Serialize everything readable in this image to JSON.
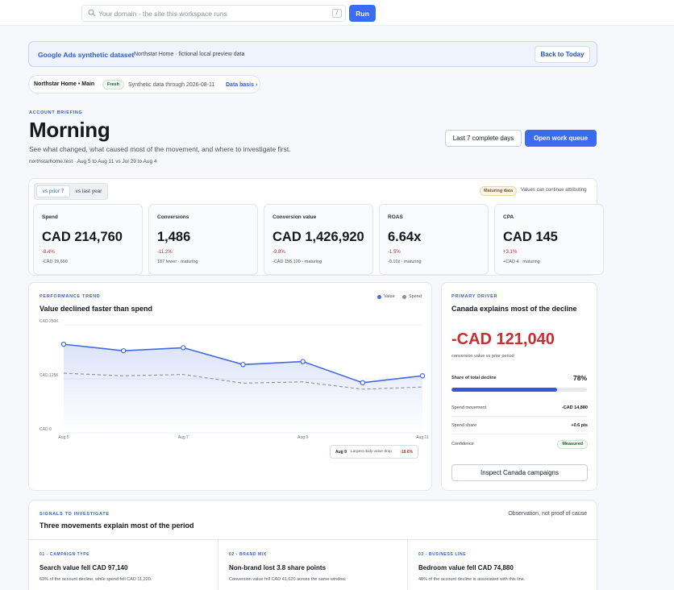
{
  "topbar": {
    "search_placeholder": "Your domain - the site this workspace runs",
    "shortcut_key": "/",
    "run_label": "Run"
  },
  "banner": {
    "title": "Google Ads synthetic dataset",
    "subtitle": "Northstar Home · fictional local preview data",
    "back_label": "Back to Today"
  },
  "context": {
    "account": "Northstar Home • Main",
    "fresh_badge": "Fresh",
    "through": "Synthetic data through 2026-08-11",
    "link": "Data basis ›"
  },
  "hero": {
    "eyebrow": "ACCOUNT BRIEFING",
    "title": "Morning",
    "subtitle": "See what changed, what caused most of the movement, and where to investigate first.",
    "meta": "northstarhome.test · Aug 5 to Aug 11 vs Jul 29 to Aug 4",
    "range_label": "Last 7 complete days",
    "queue_label": "Open work queue"
  },
  "kpis": {
    "toggle": [
      "vs prior 7",
      "vs last year"
    ],
    "maturing_badge": "Maturing data",
    "maturing_note": "Values can continue attributing",
    "cards": [
      {
        "label": "Spend",
        "value": "CAD 214,760",
        "delta": "-8.4%",
        "note": "-CAD 19,690"
      },
      {
        "label": "Conversions",
        "value": "1,486",
        "delta": "-11.2%",
        "note": "187 fewer · maturing"
      },
      {
        "label": "Conversion value",
        "value": "CAD 1,426,920",
        "delta": "-9.8%",
        "note": "-CAD 155,120 · maturing"
      },
      {
        "label": "ROAS",
        "value": "6.64x",
        "delta": "-1.5%",
        "note": "-0.10x · maturing"
      },
      {
        "label": "CPA",
        "value": "CAD 145",
        "delta": "+3.1%",
        "note": "+CAD 4 · maturing"
      }
    ]
  },
  "trend": {
    "eyebrow": "PERFORMANCE TREND",
    "title": "Value declined faster than spend",
    "tooltip": {
      "date": "Aug 9",
      "text": "Largest daily value drop",
      "value": "-18.6%"
    }
  },
  "chart_data": {
    "type": "line",
    "x": [
      "Aug 5",
      "Aug 6",
      "Aug 7",
      "Aug 8",
      "Aug 9",
      "Aug 10",
      "Aug 11"
    ],
    "x_tick_labels": [
      "Aug 5",
      "Aug 7",
      "Aug 9",
      "Aug 11"
    ],
    "y_tick_labels": [
      "CAD 250K",
      "CAD 125K",
      "CAD 0"
    ],
    "ylim": [
      0,
      250000
    ],
    "series": [
      {
        "name": "Value",
        "color": "#4169e1",
        "values": [
          205000,
          190000,
          197000,
          158000,
          165000,
          116000,
          132000
        ]
      },
      {
        "name": "Spend",
        "color": "#8a8f98",
        "values": [
          138000,
          132000,
          135000,
          115000,
          118000,
          101000,
          106000
        ]
      }
    ],
    "legend_position": "top-right",
    "grid": true
  },
  "driver": {
    "eyebrow": "PRIMARY DRIVER",
    "title": "Canada explains most of the decline",
    "value": "-CAD 121,040",
    "caption": "conversion value vs prior period",
    "share_label": "Share of total decline",
    "share_value": "78%",
    "share_fraction": 0.78,
    "rows": [
      {
        "label": "Spend movement",
        "value": "-CAD 14,880"
      },
      {
        "label": "Spend share",
        "value": "+0.6 pts"
      },
      {
        "label": "Confidence",
        "value": "Measured"
      }
    ],
    "inspect_label": "Inspect Canada campaigns"
  },
  "signals": {
    "eyebrow": "SIGNALS TO INVESTIGATE",
    "title": "Three movements explain most of the period",
    "note": "Observation, not proof of cause",
    "items": [
      {
        "tag": "01 - CAMPAIGN TYPE",
        "title": "Search value fell CAD 97,140",
        "desc": "63% of the account decline, while spend fell CAD 11,220."
      },
      {
        "tag": "02 - BRAND MIX",
        "title": "Non-brand lost 3.8 share points",
        "desc": "Conversion value fell CAD 41,620 across the same window."
      },
      {
        "tag": "03 - BUSINESS LINE",
        "title": "Bedroom value fell CAD 74,880",
        "desc": "48% of the account decline is associated with this line."
      }
    ]
  }
}
